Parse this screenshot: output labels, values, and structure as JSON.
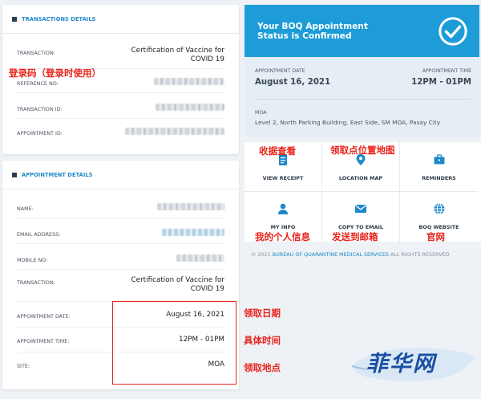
{
  "transactions": {
    "title": "TRANSACTIONS DETAILS",
    "rows": [
      {
        "label": "TRANSACTION:",
        "value": "Certification of Vaccine for COVID 19"
      },
      {
        "label": "REFERENCE NO:",
        "value": ""
      },
      {
        "label": "TRANSACTION ID:",
        "value": ""
      },
      {
        "label": "APPOINTMENT ID:",
        "value": ""
      }
    ]
  },
  "appointment_details": {
    "title": "APPOINTMENT DETAILS",
    "rows": [
      {
        "label": "NAME:",
        "value": ""
      },
      {
        "label": "EMAIL ADDRESS:",
        "value": ""
      },
      {
        "label": "MOBILE NO:",
        "value": ""
      },
      {
        "label": "TRANSACTION:",
        "value": "Certification of Vaccine for COVID 19"
      },
      {
        "label": "APPOINTMENT DATE:",
        "value": "August 16, 2021"
      },
      {
        "label": "APPOINTMENT TIME:",
        "value": "12PM - 01PM"
      },
      {
        "label": "SITE:",
        "value": "MOA"
      }
    ]
  },
  "banner": {
    "text": "Your BOQ Appointment Status is Confirmed",
    "icon": "check-circle-icon",
    "color": "#1d9cd8"
  },
  "summary": {
    "date_label": "APPOINTMENT DATE",
    "date_value": "August 16, 2021",
    "time_label": "APPOINTMENT TIME",
    "time_value": "12PM - 01PM",
    "site_label": "MOA",
    "site_value": "Level 2, North Parking Building, East Side, SM MOA, Pasay City"
  },
  "actions": [
    {
      "label": "VIEW RECEIPT",
      "icon": "receipt-icon"
    },
    {
      "label": "LOCATION MAP",
      "icon": "map-pin-icon"
    },
    {
      "label": "REMINDERS",
      "icon": "briefcase-icon"
    },
    {
      "label": "MY INFO",
      "icon": "user-icon"
    },
    {
      "label": "COPY TO EMAIL",
      "icon": "envelope-icon"
    },
    {
      "label": "BOQ WEBSITE",
      "icon": "globe-icon"
    }
  ],
  "footer": {
    "prefix": "© 2021",
    "link": "BUREAU OF QUARANTINE MEDICAL SERVICES",
    "suffix": "ALL RIGHTS RESERVED"
  },
  "annotations": {
    "reference": "登录码（登录时使用）",
    "receipt": "收据查看",
    "map": "领取点位置地图",
    "myinfo": "我的个人信息",
    "email": "发送到邮箱",
    "website": "官网",
    "date": "领取日期",
    "time": "具体时间",
    "site": "领取地点"
  },
  "watermark": "菲华网",
  "colors": {
    "accent": "#1e88c8",
    "banner": "#1d9cd8",
    "annotation": "#e8231b"
  }
}
